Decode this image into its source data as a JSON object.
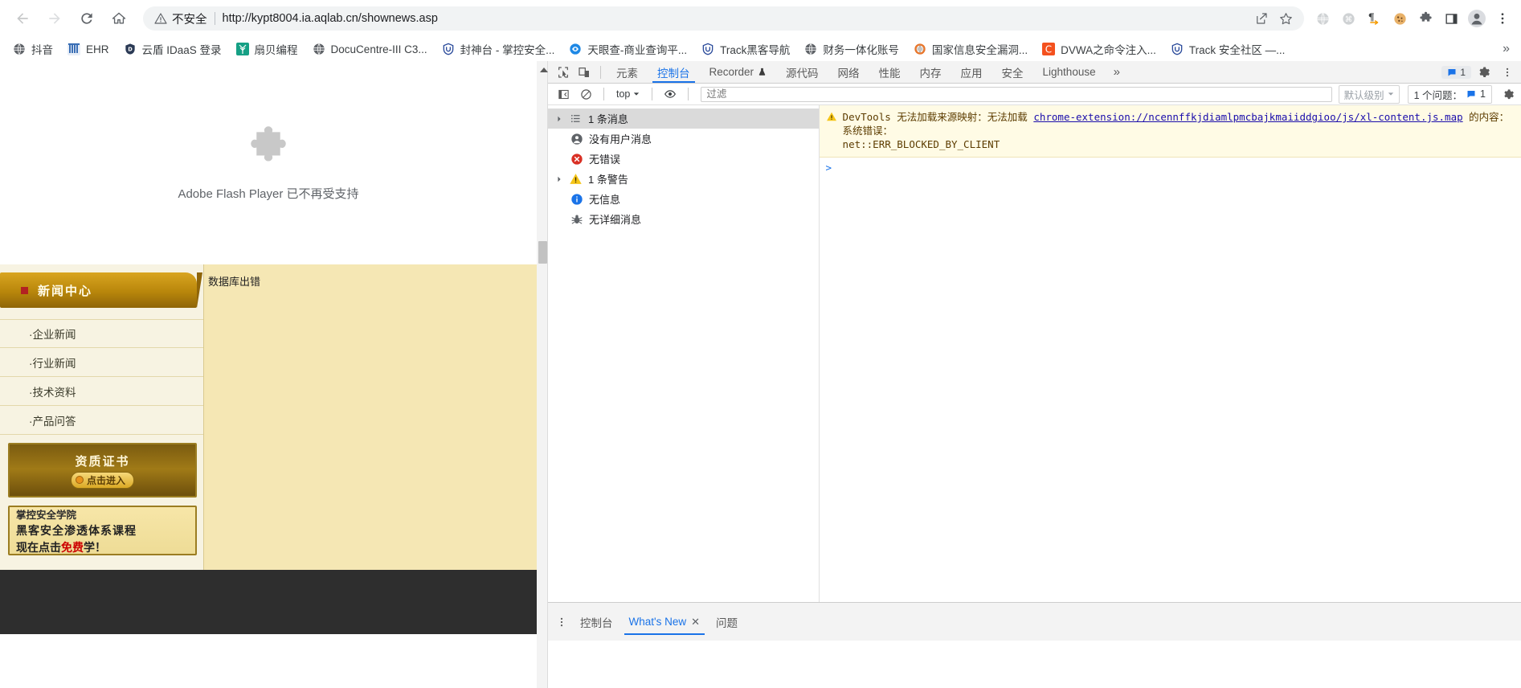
{
  "browser": {
    "nav": {
      "back": "back-arrow",
      "forward": "forward-arrow",
      "reload": "reload",
      "home": "home"
    },
    "omnibox": {
      "security_label": "不安全",
      "url": "http://kypt8004.ia.aqlab.cn/shownews.asp",
      "share_icon": "share-icon",
      "bookmark_icon": "star-icon"
    },
    "extensions": [
      {
        "name": "globe-extension-icon",
        "glyph": "🌐"
      },
      {
        "name": "command-extension-icon",
        "glyph": "⌘"
      },
      {
        "name": "paragraph-extension-icon",
        "glyph": "¶"
      },
      {
        "name": "cookie-extension-icon",
        "glyph": "🍪"
      },
      {
        "name": "puzzle-extensions-icon",
        "glyph": "🧩"
      },
      {
        "name": "side-panel-icon",
        "glyph": "□"
      },
      {
        "name": "profile-avatar-icon",
        "glyph": "👤"
      },
      {
        "name": "chrome-menu-icon",
        "glyph": "⋮"
      }
    ],
    "bookmarks": [
      {
        "label": "抖音",
        "favicon": "globe",
        "color": "#5f6368"
      },
      {
        "label": "EHR",
        "favicon": "grid",
        "color": "#3b6fb5"
      },
      {
        "label": "云盾 IDaaS 登录",
        "favicon": "shield-d",
        "color": "#2b3a55"
      },
      {
        "label": "扇贝编程",
        "favicon": "leaf",
        "color": "#16a085"
      },
      {
        "label": "DocuCentre-III C3...",
        "favicon": "globe",
        "color": "#5f6368"
      },
      {
        "label": "封神台 - 掌控安全...",
        "favicon": "shield-u",
        "color": "#2b4b9b"
      },
      {
        "label": "天眼查-商业查询平...",
        "favicon": "eye",
        "color": "#1e88e5"
      },
      {
        "label": "Track黑客导航",
        "favicon": "shield-u",
        "color": "#2b4b9b"
      },
      {
        "label": "财务一体化账号",
        "favicon": "globe",
        "color": "#5f6368"
      },
      {
        "label": "国家信息安全漏洞...",
        "favicon": "globe-orange",
        "color": "#e8762c"
      },
      {
        "label": "DVWA之命令注入...",
        "favicon": "letter-c",
        "color": "#f4511e"
      },
      {
        "label": "Track 安全社区 —...",
        "favicon": "shield-u",
        "color": "#2b4b9b"
      }
    ],
    "bookmarks_overflow": "»"
  },
  "page": {
    "flash": {
      "message": "Adobe Flash Player 已不再受支持",
      "icon": "puzzle-piece-icon"
    },
    "sidebar": {
      "header_title": "新闻中心",
      "links": [
        "·企业新闻",
        "·行业新闻",
        "·技术资料",
        "·产品问答"
      ],
      "promo_cert": {
        "title": "资质证书",
        "button": "点击进入"
      },
      "promo_course": {
        "line1": "掌控安全学院",
        "line2": "黑客安全渗透体系课程",
        "line3_pre": "现在点击",
        "line3_em": "免费",
        "line3_post": "学！"
      }
    },
    "content": {
      "db_error": "数据库出错"
    }
  },
  "devtools": {
    "tabs": [
      {
        "label": "元素",
        "active": false
      },
      {
        "label": "控制台",
        "active": true
      },
      {
        "label": "Recorder",
        "active": false,
        "badge": "flask"
      },
      {
        "label": "源代码",
        "active": false
      },
      {
        "label": "网络",
        "active": false
      },
      {
        "label": "性能",
        "active": false
      },
      {
        "label": "内存",
        "active": false
      },
      {
        "label": "应用",
        "active": false
      },
      {
        "label": "安全",
        "active": false
      },
      {
        "label": "Lighthouse",
        "active": false
      }
    ],
    "tabs_overflow": "»",
    "tool_buttons": [
      {
        "name": "inspect-element-icon"
      },
      {
        "name": "device-toolbar-icon"
      }
    ],
    "header_right": {
      "issues_count": "1",
      "settings_icon": "gear-icon",
      "more_icon": "more-vertical-icon"
    },
    "console_toolbar": {
      "sidebar_toggle_icon": "sidebar-toggle-icon",
      "clear_console_icon": "clear-console-icon",
      "context": "top",
      "eye_icon": "live-expression-icon",
      "filter_placeholder": "过滤",
      "filter_value": "",
      "level_label": "默认级别",
      "issues_label": "1 个问题：",
      "issues_badge": "1",
      "settings_icon": "console-settings-icon"
    },
    "console_sidebar": [
      {
        "label": "1 条消息",
        "icon": "list-icon",
        "expandable": true,
        "selected": true,
        "indent": false
      },
      {
        "label": "没有用户消息",
        "icon": "user-icon",
        "expandable": false,
        "selected": false,
        "indent": true
      },
      {
        "label": "无错误",
        "icon": "error-icon",
        "expandable": false,
        "selected": false,
        "indent": true
      },
      {
        "label": "1 条警告",
        "icon": "warning-icon",
        "expandable": true,
        "selected": false,
        "indent": false
      },
      {
        "label": "无信息",
        "icon": "info-icon",
        "expandable": false,
        "selected": false,
        "indent": true
      },
      {
        "label": "无详细消息",
        "icon": "verbose-icon",
        "expandable": false,
        "selected": false,
        "indent": true
      }
    ],
    "console_message": {
      "icon": "warning-icon",
      "prefix": "DevTools 无法加载来源映射：无法加载 ",
      "link": "chrome-extension://ncennffkjdiamlpmcbajkmaiiddgioo/js/xl-content.js.map",
      "mid": " 的内容：系统错误：",
      "suffix": "net::ERR_BLOCKED_BY_CLIENT"
    },
    "prompt_marker": ">",
    "drawer": {
      "more_icon": "more-vertical-icon",
      "tabs": [
        {
          "label": "控制台",
          "active": false,
          "closable": false
        },
        {
          "label": "What's New",
          "active": true,
          "closable": true
        },
        {
          "label": "问题",
          "active": false,
          "closable": false
        }
      ]
    }
  },
  "colors": {
    "accent": "#1a73e8",
    "warning_bg": "#fffbe5",
    "warning_icon": "#f0ad00",
    "error_icon": "#d93025",
    "site_bg": "#f5e7b4",
    "gold": "#b8860b"
  }
}
